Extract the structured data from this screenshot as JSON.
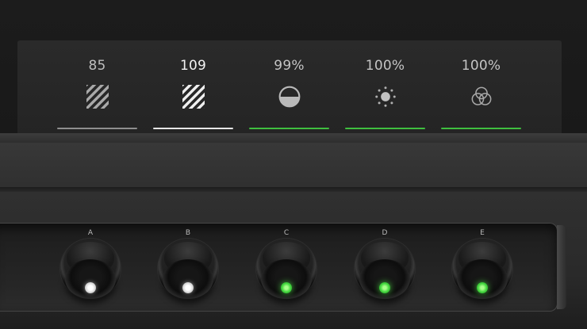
{
  "display": {
    "readouts": [
      {
        "value": "85",
        "icon": "diagonal-stripes-icon",
        "value_color": "#bdbdbd",
        "bar_color": "#8e8e8e"
      },
      {
        "value": "109",
        "icon": "diagonal-stripes-icon",
        "value_color": "#f2f2f2",
        "bar_color": "#e6e6e6"
      },
      {
        "value": "99%",
        "icon": "half-circle-icon",
        "value_color": "#c4c4c4",
        "bar_color": "#3fbf3f"
      },
      {
        "value": "100%",
        "icon": "sun-icon",
        "value_color": "#c4c4c4",
        "bar_color": "#3fbf3f"
      },
      {
        "value": "100%",
        "icon": "color-circles-icon",
        "value_color": "#c4c4c4",
        "bar_color": "#3fbf3f"
      }
    ]
  },
  "knobs": [
    {
      "label": "A",
      "led": "white"
    },
    {
      "label": "B",
      "led": "white"
    },
    {
      "label": "C",
      "led": "green"
    },
    {
      "label": "D",
      "led": "green"
    },
    {
      "label": "E",
      "led": "green"
    }
  ]
}
